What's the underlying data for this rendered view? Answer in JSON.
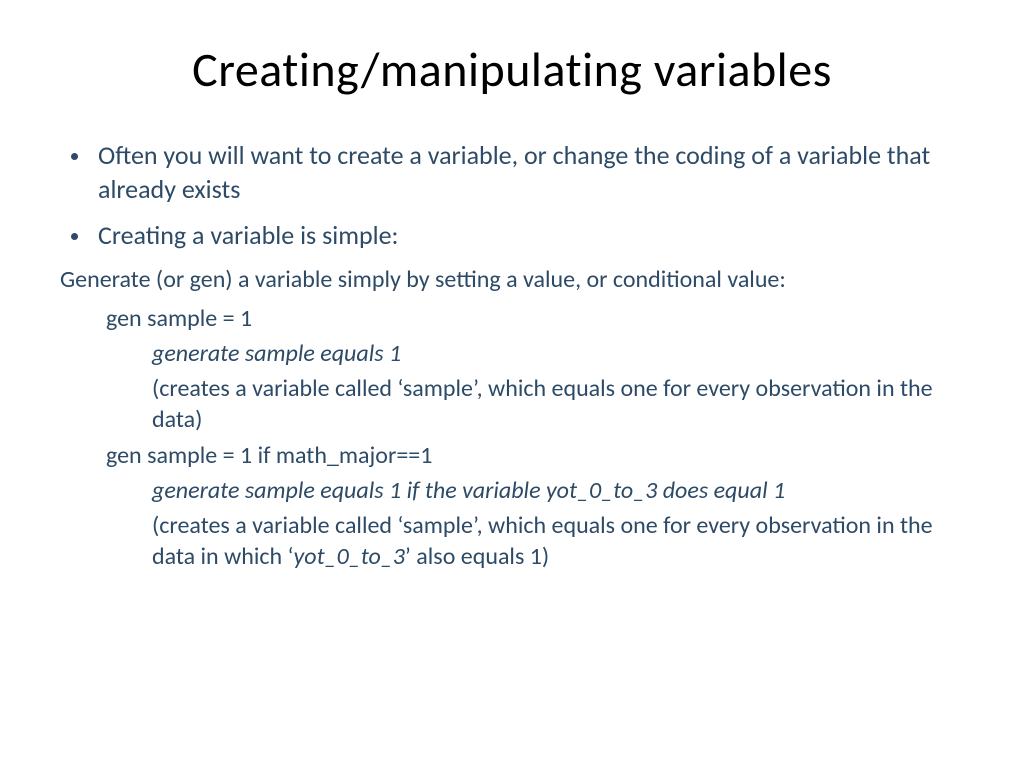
{
  "slide": {
    "title": "Creating/manipulating variables",
    "bullets": [
      "Often you will want to create a variable, or change the coding of a variable that already exists",
      "Creating a variable is simple:"
    ],
    "intro_line": "Generate (or gen) a variable simply by setting a value, or conditional value:",
    "example1": {
      "code": "gen sample = 1",
      "meaning": "generate sample equals 1",
      "explanation": "(creates a variable called ‘sample’, which equals one for every observation in the data)"
    },
    "example2": {
      "code": "gen sample = 1 if math_major==1",
      "meaning": "generate sample equals 1 if the variable yot_0_to_3 does equal 1",
      "expl_prefix": "(creates a variable called ‘sample’, which equals one for every observation in the data in which ‘",
      "expl_var": "yot_0_to_3",
      "expl_suffix": "’ also equals 1)"
    }
  }
}
